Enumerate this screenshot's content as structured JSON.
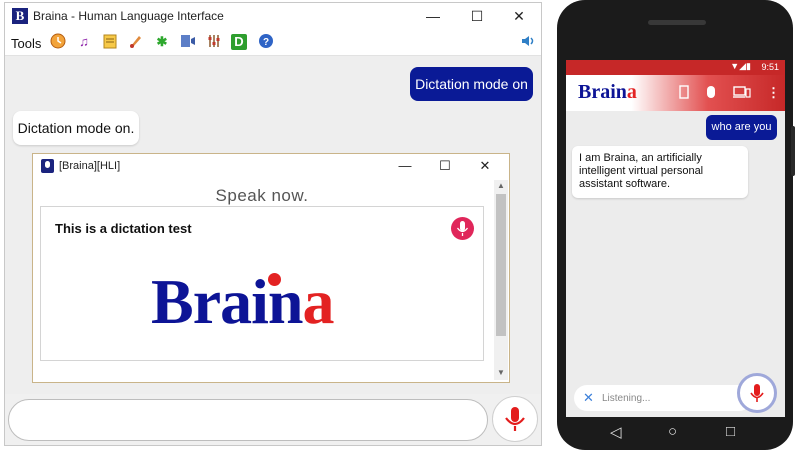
{
  "desktop": {
    "window_title": "Braina - Human Language Interface",
    "app_logo_letter": "B",
    "window_buttons": {
      "minimize": "—",
      "maximize": "☐",
      "close": "✕"
    },
    "toolbar": {
      "tools_label": "Tools",
      "icons": [
        "clock-icon",
        "music-icon",
        "notes-icon",
        "brush-icon",
        "asterisk-icon",
        "screen-reader-icon",
        "settings-icon",
        "dictionary-icon",
        "help-icon",
        "volume-icon"
      ]
    },
    "chat": {
      "user_message": "Dictation mode on",
      "bot_message": "Dictation mode on."
    },
    "dictation_dialog": {
      "title": "[Braina][HLI]",
      "prompt": "Speak now.",
      "dictated_text": "This is a dictation test",
      "brand_main": "Brain",
      "brand_last": "a"
    },
    "input": {
      "placeholder": ""
    },
    "colors": {
      "user_bubble": "#0a1a96",
      "brand_blue": "#0d1496",
      "brand_red": "#e32222",
      "mic_red": "#e0265a"
    }
  },
  "mobile": {
    "status_time": "9:51",
    "app_title_main": "Brain",
    "app_title_last": "a",
    "user_message": "who are you",
    "bot_message": "I am Braina, an artificially intelligent virtual personal assistant software.",
    "input_placeholder": "Listening...",
    "colors": {
      "status_bar": "#c62828",
      "user_bubble": "#0a1a96"
    }
  }
}
